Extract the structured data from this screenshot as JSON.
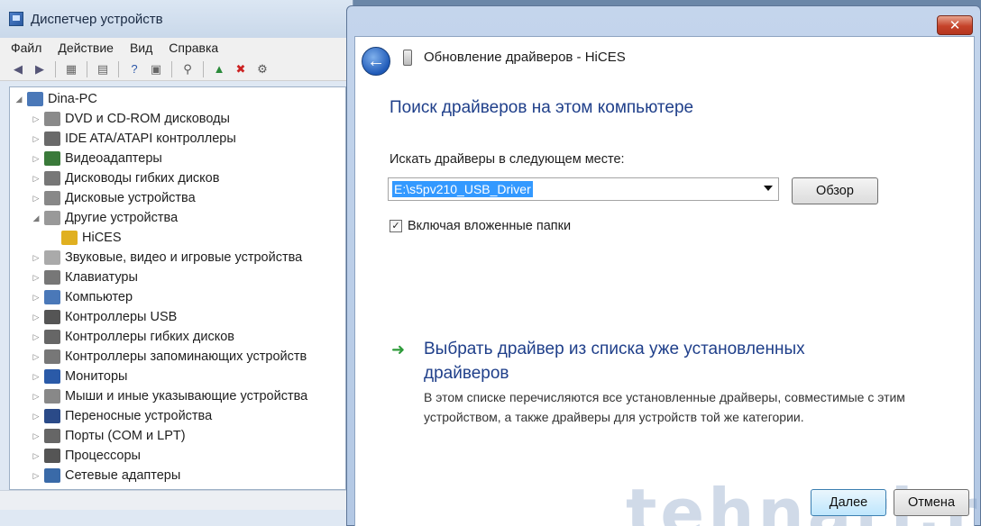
{
  "device_manager": {
    "title": "Диспетчер устройств",
    "menu": [
      "Файл",
      "Действие",
      "Вид",
      "Справка"
    ],
    "tree": [
      {
        "label": "Dina-PC",
        "level": 0,
        "expanded": true,
        "icon": "computer-icon"
      },
      {
        "label": "DVD и CD-ROM дисководы",
        "level": 1,
        "icon": "dvd-drive-icon"
      },
      {
        "label": "IDE ATA/ATAPI контроллеры",
        "level": 1,
        "icon": "ide-controller-icon"
      },
      {
        "label": "Видеоадаптеры",
        "level": 1,
        "icon": "display-adapter-icon"
      },
      {
        "label": "Дисководы гибких дисков",
        "level": 1,
        "icon": "floppy-drive-icon"
      },
      {
        "label": "Дисковые устройства",
        "level": 1,
        "icon": "disk-drive-icon"
      },
      {
        "label": "Другие устройства",
        "level": 1,
        "expanded": true,
        "icon": "other-devices-icon"
      },
      {
        "label": "HiCES",
        "level": 2,
        "icon": "warning-device-icon"
      },
      {
        "label": "Звуковые, видео и игровые устройства",
        "level": 1,
        "icon": "sound-icon"
      },
      {
        "label": "Клавиатуры",
        "level": 1,
        "icon": "keyboard-icon"
      },
      {
        "label": "Компьютер",
        "level": 1,
        "icon": "computer-icon"
      },
      {
        "label": "Контроллеры USB",
        "level": 1,
        "icon": "usb-icon"
      },
      {
        "label": "Контроллеры гибких дисков",
        "level": 1,
        "icon": "floppy-controller-icon"
      },
      {
        "label": "Контроллеры запоминающих устройств",
        "level": 1,
        "icon": "storage-controller-icon"
      },
      {
        "label": "Мониторы",
        "level": 1,
        "icon": "monitor-icon"
      },
      {
        "label": "Мыши и иные указывающие устройства",
        "level": 1,
        "icon": "mouse-icon"
      },
      {
        "label": "Переносные устройства",
        "level": 1,
        "icon": "portable-device-icon"
      },
      {
        "label": "Порты (COM и LPT)",
        "level": 1,
        "icon": "port-icon"
      },
      {
        "label": "Процессоры",
        "level": 1,
        "icon": "processor-icon"
      },
      {
        "label": "Сетевые адаптеры",
        "level": 1,
        "icon": "network-adapter-icon"
      }
    ]
  },
  "dialog": {
    "title": "Обновление драйверов - HiCES",
    "heading": "Поиск драйверов на этом компьютере",
    "search_label": "Искать драйверы в следующем месте:",
    "path_value": "E:\\s5pv210_USB_Driver",
    "browse_label": "Обзор",
    "include_subfolders_label": "Включая вложенные папки",
    "include_subfolders_checked": true,
    "pick_title": "Выбрать драйвер из списка уже установленных драйверов",
    "pick_desc": "В этом списке перечисляются все установленные драйверы, совместимые с этим устройством, а также драйверы для устройств той же категории.",
    "next_label": "Далее",
    "cancel_label": "Отмена"
  },
  "watermark": "tehnari.ru"
}
